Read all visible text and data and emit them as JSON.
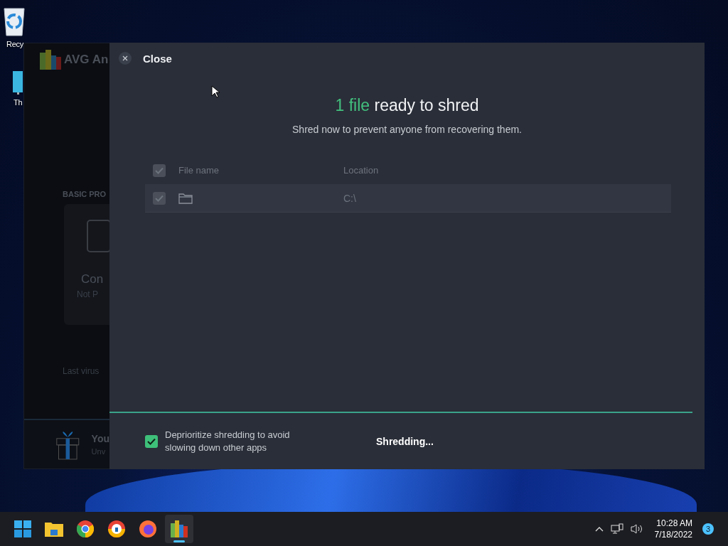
{
  "desktop_icons": [
    {
      "kind": "recycle",
      "label": "Recy"
    },
    {
      "kind": "pc",
      "label": "Th"
    }
  ],
  "background_window": {
    "app_name": "AVG An",
    "section": "BASIC PRO",
    "card_title": "Con",
    "card_status": "Not P",
    "last_scan": "Last virus",
    "promo_title": "You",
    "promo_sub": "Unv"
  },
  "dialog": {
    "close_label": "Close",
    "title_highlight": "1 file",
    "title_rest": "ready to shred",
    "subtitle": "Shred now to prevent anyone from recovering them.",
    "table": {
      "header_checkbox": {
        "checked": true,
        "disabled": true
      },
      "columns": [
        "File name",
        "Location"
      ],
      "rows": [
        {
          "checked": true,
          "disabled": true,
          "location": "C:\\"
        }
      ]
    },
    "progress": {
      "level": 0.98
    },
    "option": {
      "checked": true,
      "label": "Deprioritize shredding to avoid slowing down other apps"
    },
    "status": "Shredding..."
  },
  "taskbar": {
    "apps": [
      {
        "kind": "start",
        "active": false
      },
      {
        "kind": "folder",
        "active": false
      },
      {
        "kind": "chrome",
        "active": false
      },
      {
        "kind": "secure",
        "active": false
      },
      {
        "kind": "firefox",
        "active": false
      },
      {
        "kind": "avg",
        "active": true
      }
    ],
    "time": "10:28 AM",
    "date": "7/18/2022",
    "notifications": "3"
  }
}
